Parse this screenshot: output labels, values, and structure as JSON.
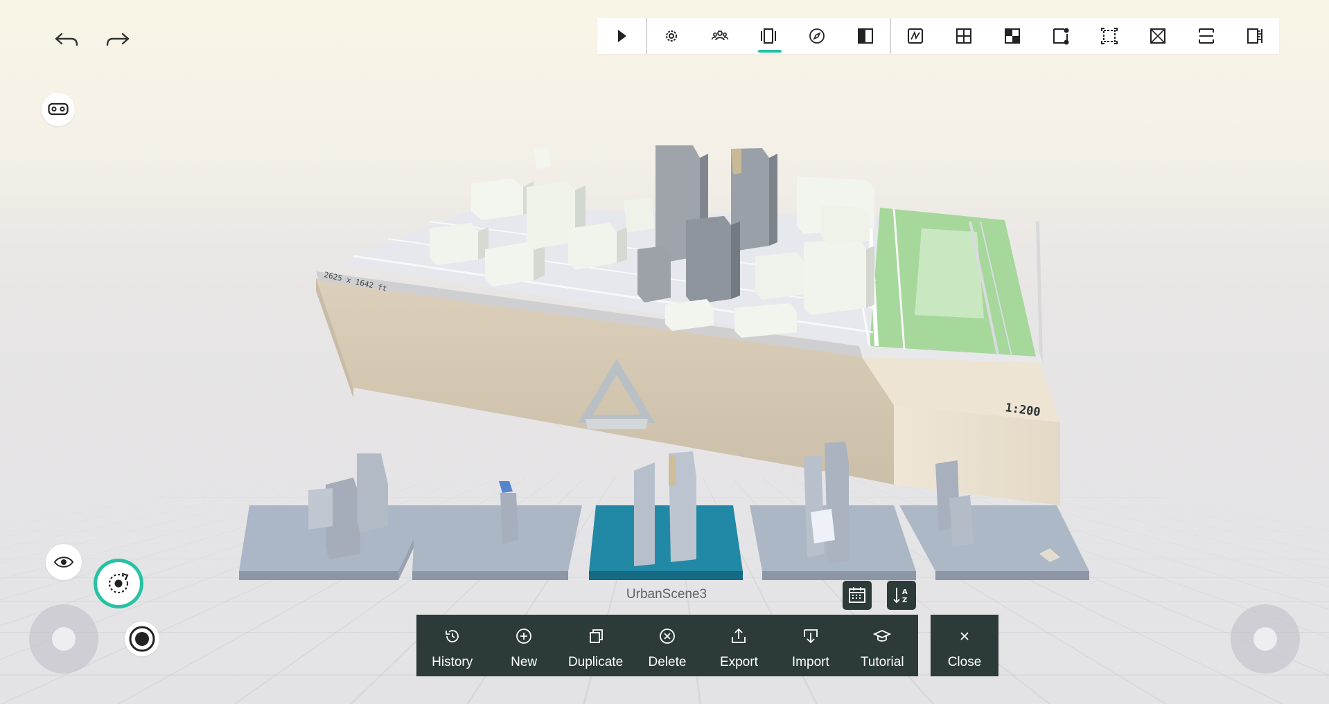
{
  "history_nav": {
    "undo_icon": "undo-arrow-icon",
    "redo_icon": "redo-arrow-icon"
  },
  "toolbar": {
    "items": [
      {
        "name": "play",
        "icon": "play-icon"
      },
      {
        "name": "settings",
        "icon": "gear-icon"
      },
      {
        "name": "collaborators",
        "icon": "people-icon"
      },
      {
        "name": "scenes",
        "icon": "scenes-icon",
        "active": true
      },
      {
        "name": "compass",
        "icon": "compass-icon"
      },
      {
        "name": "split-view",
        "icon": "split-view-icon"
      },
      {
        "name": "sketch",
        "icon": "sketch-icon"
      },
      {
        "name": "grid",
        "icon": "grid-icon"
      },
      {
        "name": "material",
        "icon": "material-icon"
      },
      {
        "name": "node-edit",
        "icon": "node-edit-icon"
      },
      {
        "name": "transform",
        "icon": "transform-icon"
      },
      {
        "name": "section",
        "icon": "section-box-icon"
      },
      {
        "name": "level",
        "icon": "level-icon"
      },
      {
        "name": "measure",
        "icon": "ruler-icon"
      }
    ],
    "accent": "#27c2a2"
  },
  "model": {
    "scale_label": "1:200",
    "dimension_label": "2625 x 1642 ft"
  },
  "scenes": {
    "selected_label": "UrbanScene3",
    "selected_color": "#2189a6",
    "count": 5
  },
  "bottom_bar": {
    "items": [
      {
        "label": "History",
        "icon": "history-icon"
      },
      {
        "label": "New",
        "icon": "plus-circle-icon"
      },
      {
        "label": "Duplicate",
        "icon": "duplicate-icon"
      },
      {
        "label": "Delete",
        "icon": "delete-circle-icon"
      },
      {
        "label": "Export",
        "icon": "export-icon"
      },
      {
        "label": "Import",
        "icon": "import-icon"
      },
      {
        "label": "Tutorial",
        "icon": "graduation-cap-icon"
      }
    ],
    "close_label": "Close",
    "bg": "#2d3a3a"
  },
  "side_controls": {
    "vr_icon": "vr-headset-icon",
    "visibility_icon": "eye-icon",
    "orbit_icon": "orbit-icon",
    "record_icon": "record-icon"
  },
  "sort": {
    "date_icon": "calendar-sort-icon",
    "alpha_icon": "alpha-sort-icon"
  }
}
